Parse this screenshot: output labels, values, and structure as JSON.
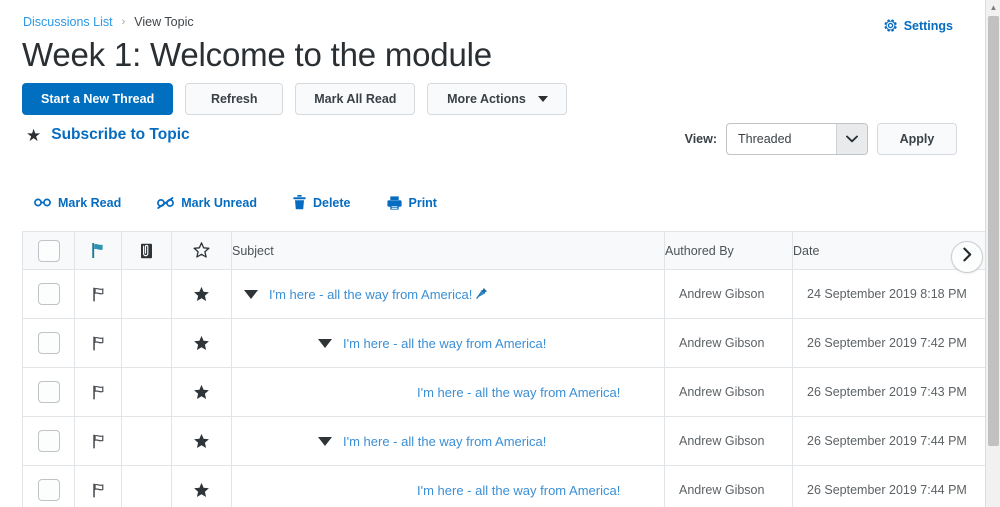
{
  "breadcrumb": {
    "link": "Discussions List",
    "separator": "›",
    "current": "View Topic"
  },
  "header": {
    "settings_label": "Settings",
    "settings_icon": "gear-icon",
    "title": "Week 1: Welcome to the module"
  },
  "actions": {
    "start_thread": "Start a New Thread",
    "refresh": "Refresh",
    "mark_all_read": "Mark All Read",
    "more_actions": "More Actions"
  },
  "subscribe": {
    "icon": "star-icon",
    "label": "Subscribe to Topic"
  },
  "view": {
    "label": "View:",
    "selected": "Threaded",
    "options": [
      "Threaded"
    ],
    "apply": "Apply"
  },
  "toolbar": {
    "items": [
      {
        "label": "Mark Read",
        "icon": "glasses-icon"
      },
      {
        "label": "Mark Unread",
        "icon": "glasses-slash-icon"
      },
      {
        "label": "Delete",
        "icon": "trash-icon"
      },
      {
        "label": "Print",
        "icon": "printer-icon"
      }
    ]
  },
  "table": {
    "headers": {
      "select_all": "select-all-checkbox",
      "flag": "flag-icon",
      "attachment": "attachment-icon",
      "star": "star-outline-icon",
      "subject": "Subject",
      "authored_by": "Authored By",
      "date": "Date"
    },
    "scroll_right_icon": "chevron-right-icon",
    "rows": [
      {
        "indent": 0,
        "has_twisty": true,
        "subject": "I'm here - all the way from America!",
        "pinned": true,
        "author": "Andrew Gibson",
        "date": "24 September 2019 8:18 PM"
      },
      {
        "indent": 1,
        "has_twisty": true,
        "subject": "I'm here - all the way from America!",
        "pinned": false,
        "author": "Andrew Gibson",
        "date": "26 September 2019 7:42 PM"
      },
      {
        "indent": 2,
        "has_twisty": false,
        "subject": "I'm here - all the way from America!",
        "pinned": false,
        "author": "Andrew Gibson",
        "date": "26 September 2019 7:43 PM"
      },
      {
        "indent": 1,
        "has_twisty": true,
        "subject": "I'm here - all the way from America!",
        "pinned": false,
        "author": "Andrew Gibson",
        "date": "26 September 2019 7:44 PM"
      },
      {
        "indent": 2,
        "has_twisty": false,
        "subject": "I'm here - all the way from America!",
        "pinned": false,
        "author": "Andrew Gibson",
        "date": "26 September 2019 7:44 PM"
      }
    ]
  },
  "colors": {
    "primary_blue": "#006fbf",
    "link_blue": "#066cc0",
    "subject_blue": "#3b8fd4",
    "breadcrumb_blue": "#2c98e6",
    "flag_teal": "#1d7b96"
  }
}
